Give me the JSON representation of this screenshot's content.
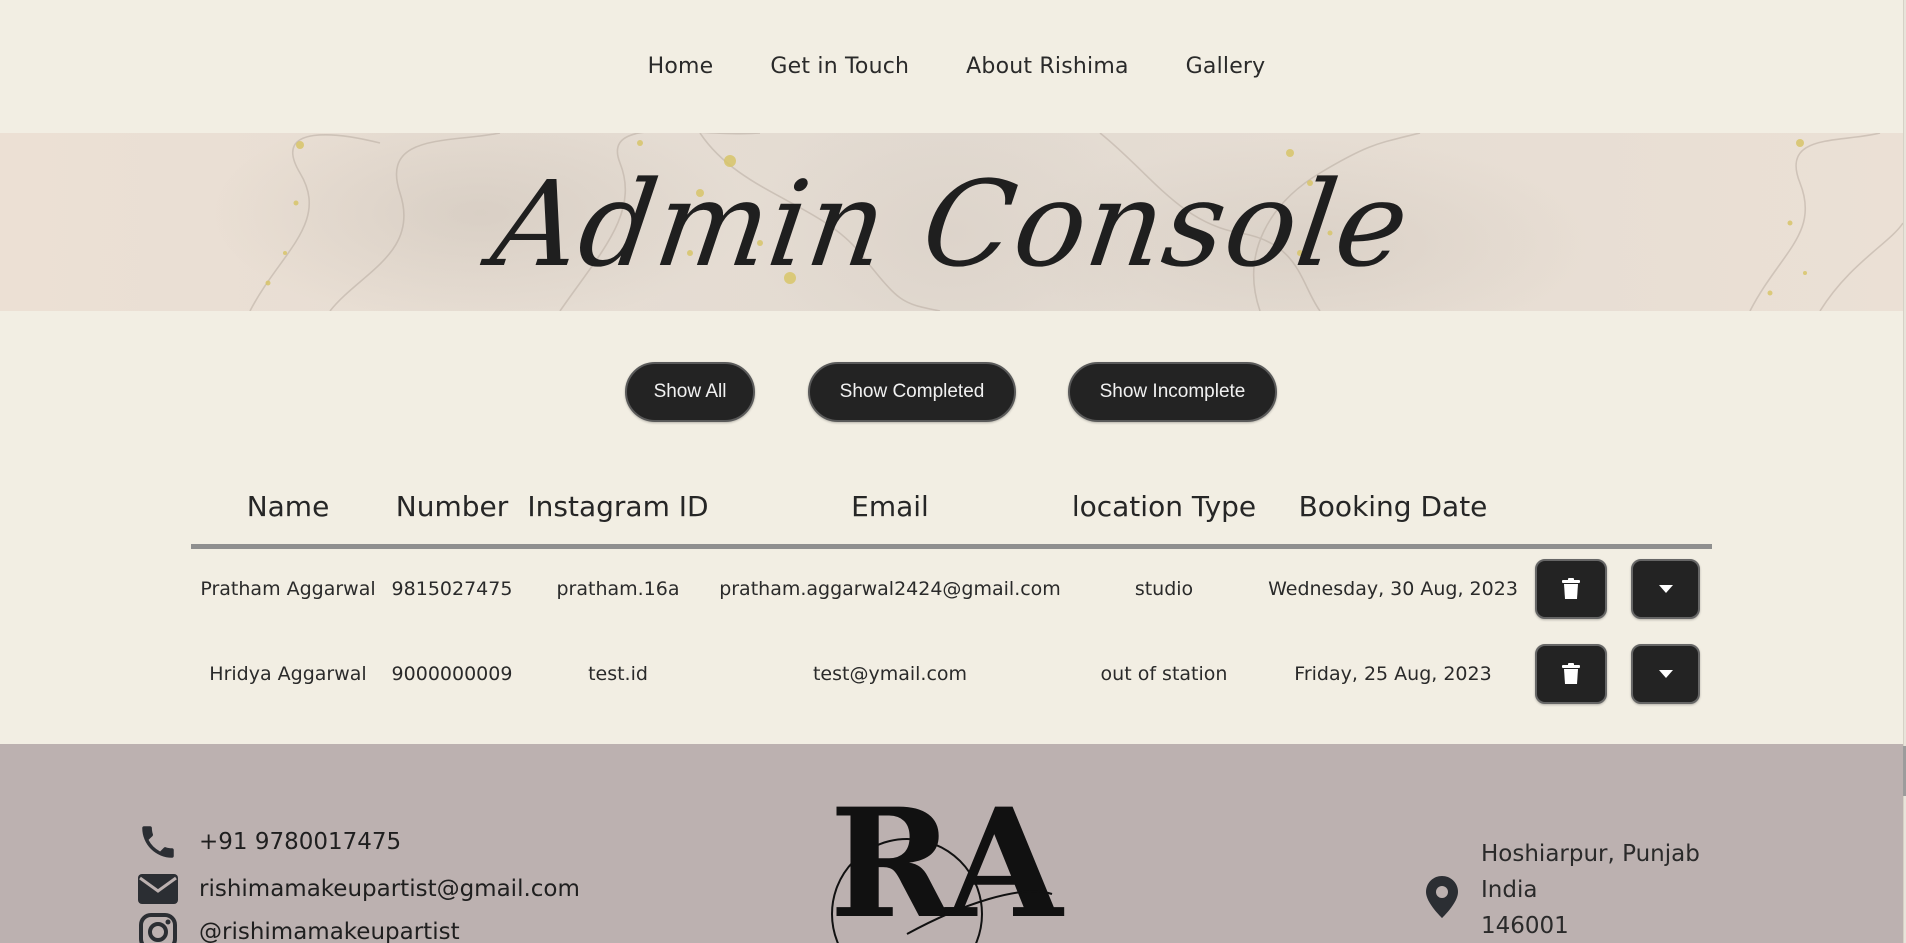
{
  "nav": {
    "items": [
      {
        "label": "Home"
      },
      {
        "label": "Get in Touch"
      },
      {
        "label": "About Rishima"
      },
      {
        "label": "Gallery"
      }
    ]
  },
  "hero": {
    "title": "Admin Console"
  },
  "filters": {
    "show_all": "Show All",
    "show_completed": "Show Completed",
    "show_incomplete": "Show Incomplete"
  },
  "table": {
    "headers": [
      "Name",
      "Number",
      "Instagram ID",
      "Email",
      "location Type",
      "Booking Date"
    ],
    "rows": [
      {
        "name": "Pratham Aggarwal",
        "number": "9815027475",
        "instagram": "pratham.16a",
        "email": "pratham.aggarwal2424@gmail.com",
        "location": "studio",
        "date": "Wednesday, 30 Aug, 2023"
      },
      {
        "name": "Hridya Aggarwal",
        "number": "9000000009",
        "instagram": "test.id",
        "email": "test@ymail.com",
        "location": "out of station",
        "date": "Friday, 25 Aug, 2023"
      }
    ],
    "row_actions": {
      "delete_icon": "trash-icon",
      "expand_icon": "caret-down-icon"
    }
  },
  "footer": {
    "phone": "+91 9780017475",
    "email": "rishimamakeupartist@gmail.com",
    "instagram": "@rishimamakeupartist",
    "logo_text": "RA",
    "address": {
      "line1": "Hoshiarpur, Punjab",
      "line2": "India",
      "line3": "146001"
    }
  },
  "colors": {
    "background": "#f2eee3",
    "button": "#232323",
    "footer": "#bcb1b0",
    "text": "#222222"
  }
}
